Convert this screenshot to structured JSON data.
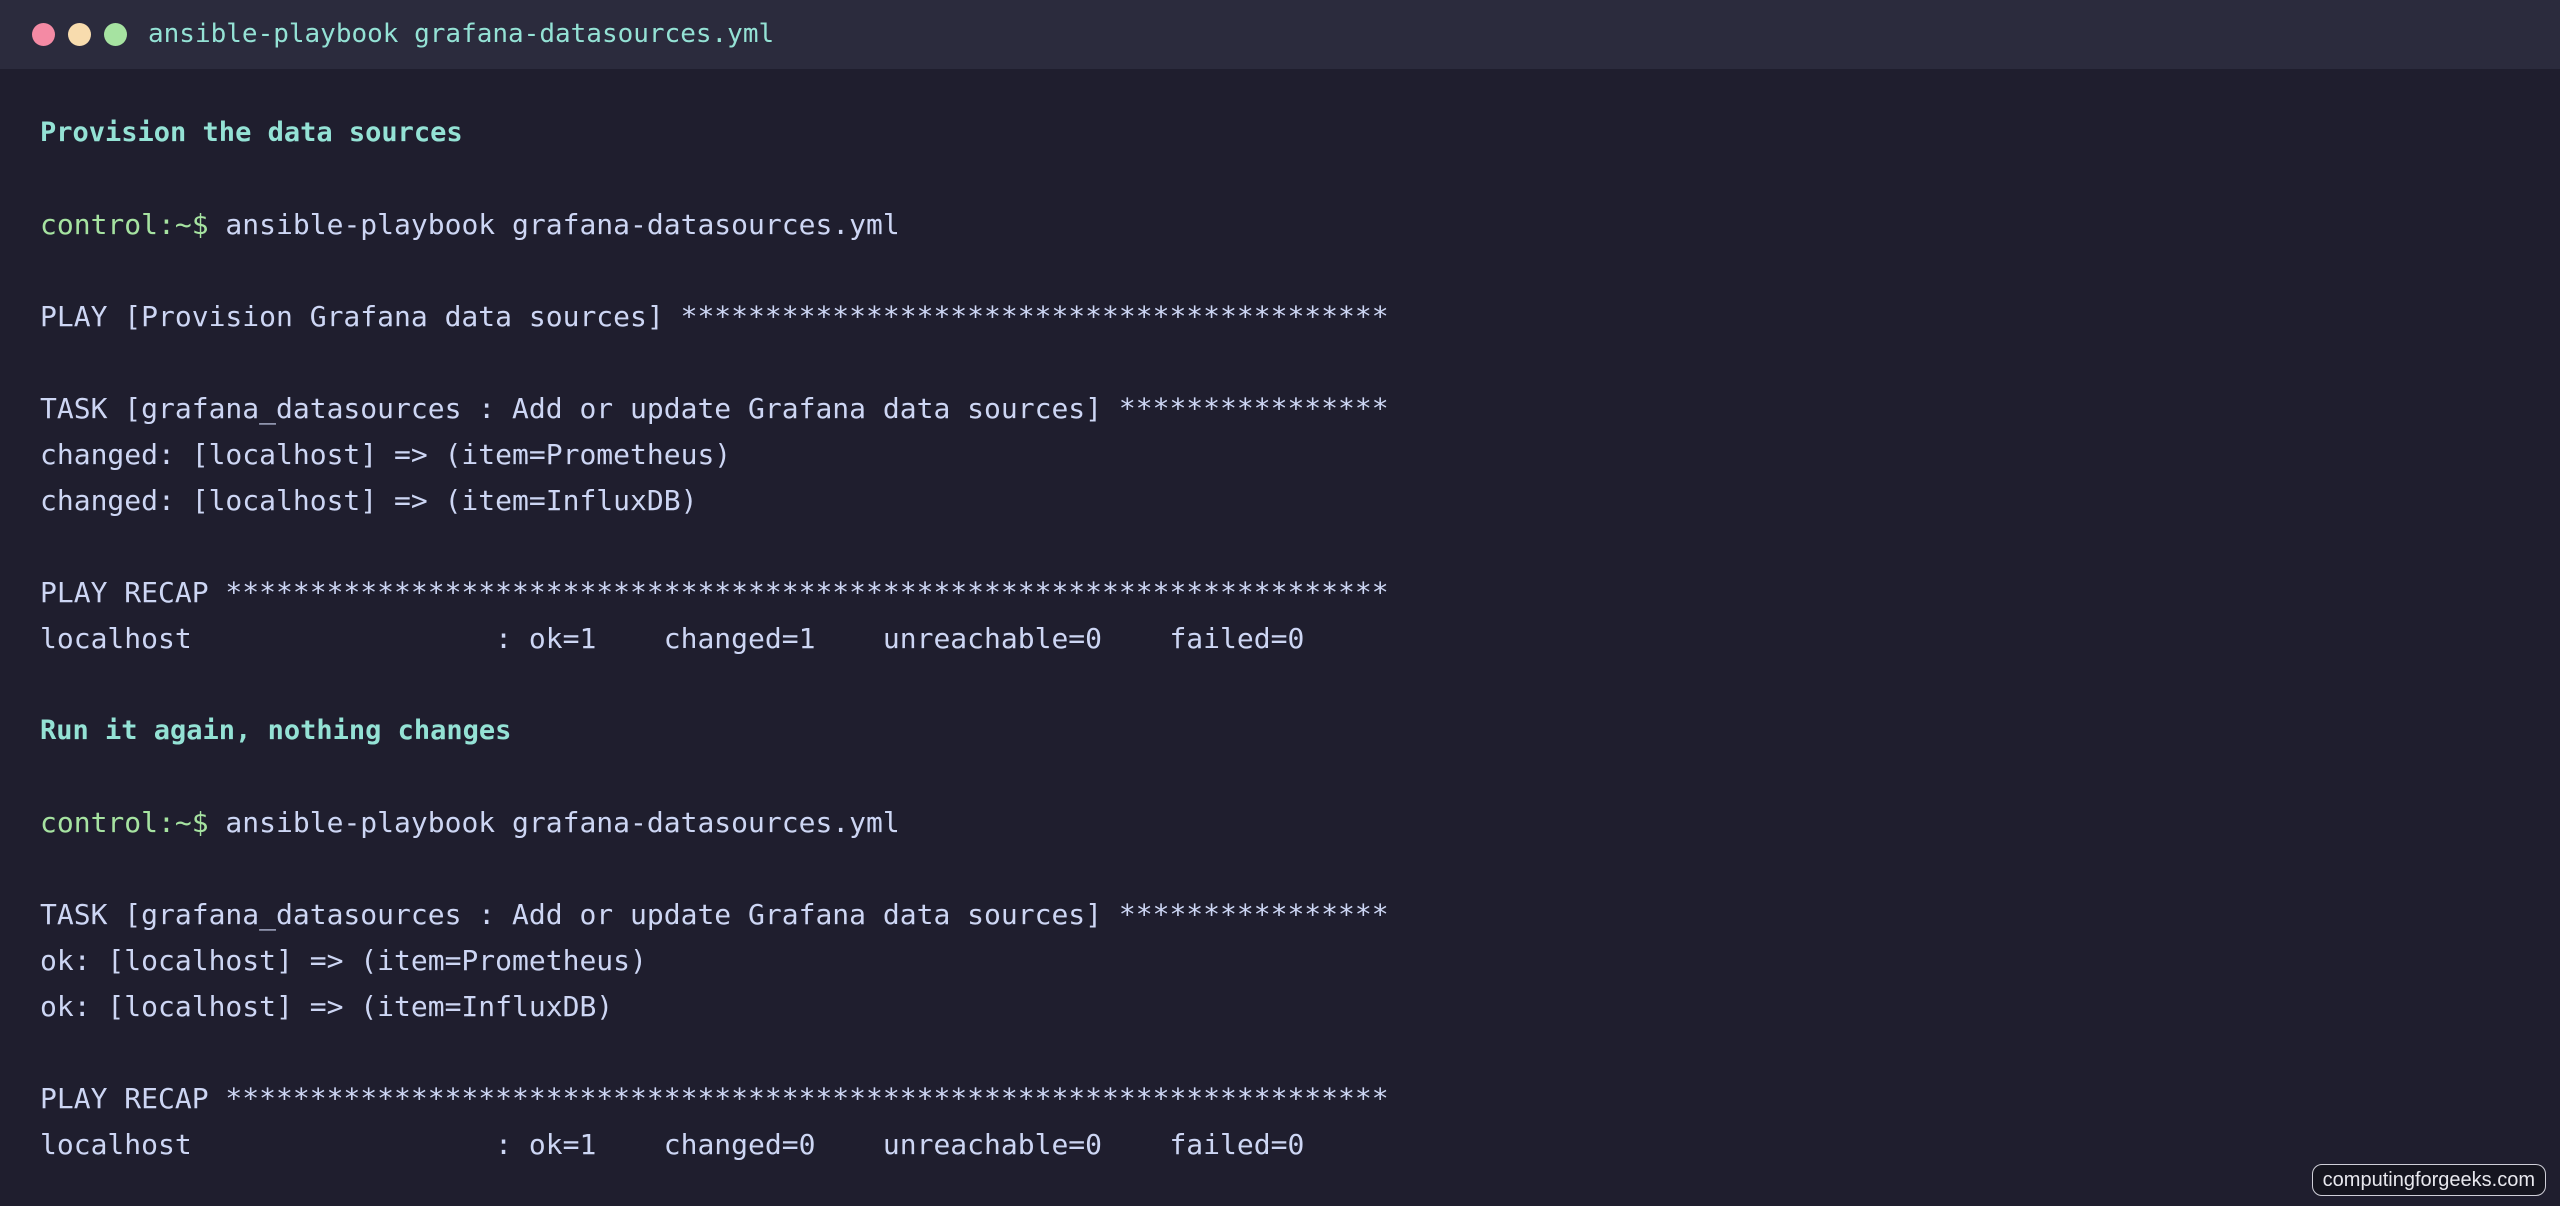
{
  "window": {
    "title": "ansible-playbook grafana-datasources.yml"
  },
  "sections": {
    "first": {
      "heading": "Provision the data sources",
      "prompt": "control:~$",
      "command": " ansible-playbook grafana-datasources.yml",
      "play_line": "PLAY [Provision Grafana data sources] ******************************************",
      "task_line": "TASK [grafana_datasources : Add or update Grafana data sources] ****************",
      "results": [
        "changed: [localhost] => (item=Prometheus)",
        "changed: [localhost] => (item=InfluxDB)"
      ],
      "recap_header": "PLAY RECAP *********************************************************************",
      "recap_line": "localhost                  : ok=1    changed=1    unreachable=0    failed=0"
    },
    "second": {
      "heading": "Run it again, nothing changes",
      "prompt": "control:~$",
      "command": " ansible-playbook grafana-datasources.yml",
      "task_line": "TASK [grafana_datasources : Add or update Grafana data sources] ****************",
      "results": [
        "ok: [localhost] => (item=Prometheus)",
        "ok: [localhost] => (item=InfluxDB)"
      ],
      "recap_header": "PLAY RECAP *********************************************************************",
      "recap_line": "localhost                  : ok=1    changed=0    unreachable=0    failed=0"
    }
  },
  "watermark": "computingforgeeks.com",
  "colors": {
    "background": "#1f1e2e",
    "titlebar": "#2b2b3d",
    "accent_teal": "#94e2d5",
    "prompt_green": "#a6e3a1",
    "text": "#cdd6f4",
    "close": "#f48aa4",
    "minimize": "#f8dcae",
    "maximize": "#a6e3a1"
  }
}
